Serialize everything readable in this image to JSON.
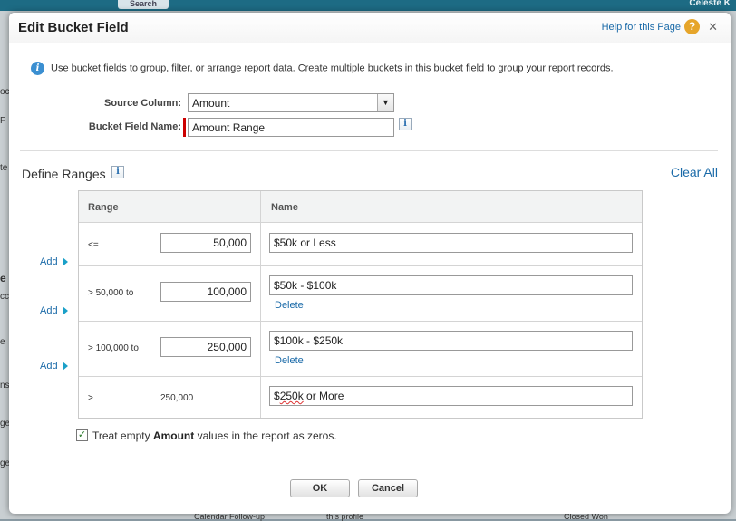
{
  "background": {
    "search_label": "Search",
    "user_name": "Celeste K",
    "stubs": [
      "oc",
      "F",
      "te",
      "e",
      "cc",
      "e",
      "ns",
      "ge",
      "ge"
    ],
    "bottom_fragments": [
      "Calendar Follow-up",
      "this profile",
      "Closed Won"
    ]
  },
  "modal": {
    "title": "Edit Bucket Field",
    "help_link": "Help for this Page",
    "help_icon": "?",
    "close_label": "✕",
    "info_text": "Use bucket fields to group, filter, or arrange report data. Create multiple buckets in this bucket field to group your report records.",
    "source_column_label": "Source Column:",
    "source_column_value": "Amount",
    "bucket_name_label": "Bucket Field Name:",
    "bucket_name_value": "Amount Range",
    "define_ranges_title": "Define Ranges",
    "clear_all": "Clear All",
    "table": {
      "col_range": "Range",
      "col_name": "Name",
      "rows": [
        {
          "prefix": "<=",
          "value": "50,000",
          "name": "$50k or Less",
          "delete": ""
        },
        {
          "prefix": "> 50,000 to",
          "value": "100,000",
          "name": "$50k - $100k",
          "delete": "Delete"
        },
        {
          "prefix": "> 100,000 to",
          "value": "250,000",
          "name": "$100k - $250k",
          "delete": "Delete"
        },
        {
          "prefix": ">",
          "value": "250,000",
          "name_plain": "$",
          "name_spell": "250k",
          "name_rest": " or More"
        }
      ]
    },
    "add_label": "Add",
    "checkbox_checked": true,
    "checkbox_pre": "Treat empty ",
    "checkbox_bold": "Amount",
    "checkbox_post": " values in the report as zeros.",
    "ok_button": "OK",
    "cancel_button": "Cancel"
  },
  "colors": {
    "link": "#1a6aa8",
    "header_bar": "#1d6b84",
    "help_icon": "#e6a52a",
    "info_icon": "#3b8fd1",
    "required": "#cc0000"
  }
}
